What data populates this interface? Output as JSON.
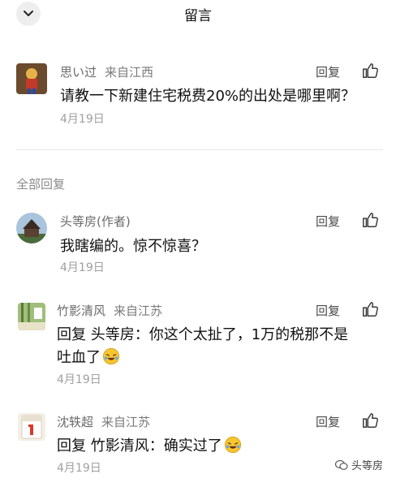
{
  "header": {
    "title": "留言"
  },
  "original": {
    "author": "思い过",
    "location": "来自江西",
    "text": "请教一下新建住宅税费20%的出处是哪里啊？",
    "date": "4月19日",
    "reply_label": "回复"
  },
  "section_label": "全部回复",
  "replies": [
    {
      "author": "头等房(作者)",
      "location": "",
      "text": "我瞎编的。惊不惊喜？",
      "date": "4月19日",
      "reply_label": "回复"
    },
    {
      "author": "竹影清风",
      "location": "来自江苏",
      "text_line1": "回复 头等房：你这个太扯了，1万的税那不是",
      "text_line2": "吐血了",
      "date": "4月19日",
      "reply_label": "回复"
    },
    {
      "author": "沈轶超",
      "location": "来自江苏",
      "text": "回复 竹影清风：确实过了",
      "date": "4月19日",
      "reply_label": "回复"
    }
  ],
  "watermark": {
    "text": "头等房"
  },
  "colors": {
    "divider": "#e6e6e6",
    "muted": "#a0a0a0",
    "text": "#111111"
  }
}
